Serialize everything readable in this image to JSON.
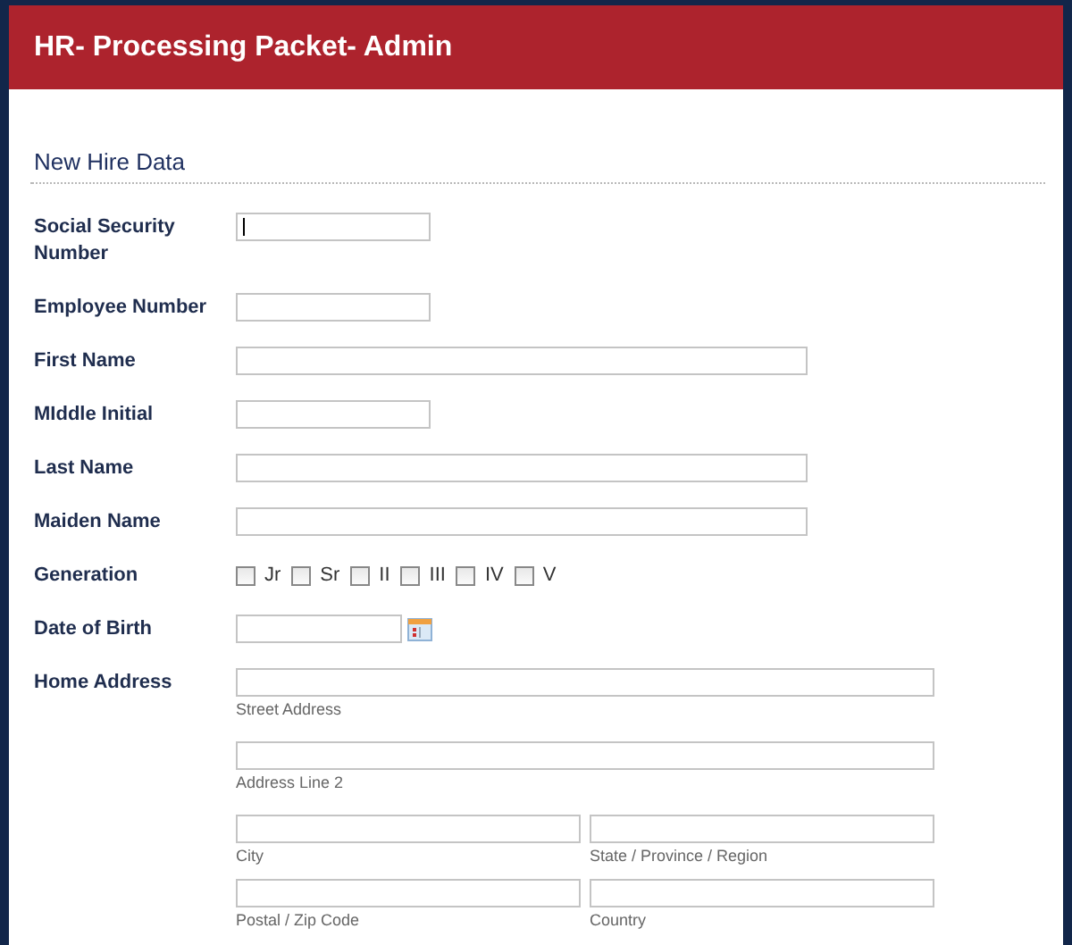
{
  "header": {
    "title": "HR- Processing Packet- Admin"
  },
  "section": {
    "title": "New Hire Data"
  },
  "fields": [
    {
      "kind": "short-text",
      "label": "Social Security Number",
      "focused": true
    },
    {
      "kind": "short-text",
      "label": "Employee Number",
      "focused": false
    },
    {
      "kind": "long-text",
      "label": "First Name",
      "focused": false
    },
    {
      "kind": "short-text",
      "label": "MIddle Initial",
      "focused": false
    },
    {
      "kind": "long-text",
      "label": "Last Name",
      "focused": false
    },
    {
      "kind": "long-text",
      "label": "Maiden Name",
      "focused": false
    },
    {
      "kind": "checkboxes",
      "label": "Generation",
      "options": [
        {
          "label": "Jr",
          "checked": false
        },
        {
          "label": "Sr",
          "checked": false
        },
        {
          "label": "II",
          "checked": false
        },
        {
          "label": "III",
          "checked": false
        },
        {
          "label": "IV",
          "checked": false
        },
        {
          "label": "V",
          "checked": false
        }
      ]
    },
    {
      "kind": "date",
      "label": "Date of Birth"
    },
    {
      "kind": "address",
      "label": "Home Address",
      "rows": [
        {
          "parts": [
            {
              "sublabel": "Street Address"
            }
          ]
        },
        {
          "parts": [
            {
              "sublabel": "Address Line 2"
            }
          ]
        },
        {
          "parts": [
            {
              "sublabel": "City"
            },
            {
              "sublabel": "State / Province / Region"
            }
          ]
        },
        {
          "parts": [
            {
              "sublabel": "Postal / Zip Code"
            },
            {
              "sublabel": "Country"
            }
          ]
        }
      ]
    }
  ]
}
